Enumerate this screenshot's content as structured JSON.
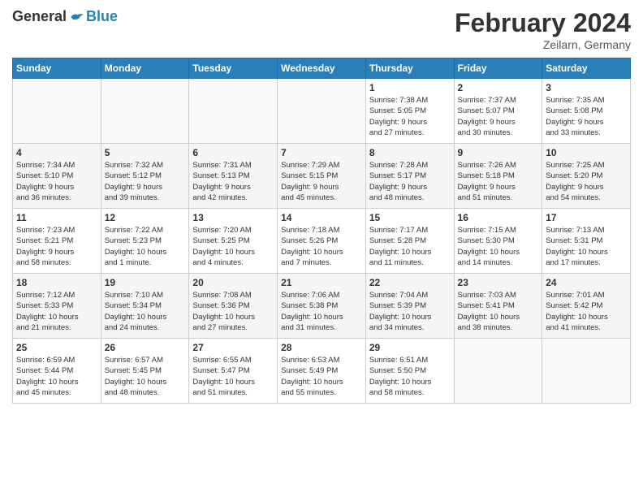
{
  "header": {
    "logo_general": "General",
    "logo_blue": "Blue",
    "title": "February 2024",
    "subtitle": "Zeilarn, Germany"
  },
  "columns": [
    "Sunday",
    "Monday",
    "Tuesday",
    "Wednesday",
    "Thursday",
    "Friday",
    "Saturday"
  ],
  "rows": [
    [
      {
        "day": "",
        "info": ""
      },
      {
        "day": "",
        "info": ""
      },
      {
        "day": "",
        "info": ""
      },
      {
        "day": "",
        "info": ""
      },
      {
        "day": "1",
        "info": "Sunrise: 7:38 AM\nSunset: 5:05 PM\nDaylight: 9 hours\nand 27 minutes."
      },
      {
        "day": "2",
        "info": "Sunrise: 7:37 AM\nSunset: 5:07 PM\nDaylight: 9 hours\nand 30 minutes."
      },
      {
        "day": "3",
        "info": "Sunrise: 7:35 AM\nSunset: 5:08 PM\nDaylight: 9 hours\nand 33 minutes."
      }
    ],
    [
      {
        "day": "4",
        "info": "Sunrise: 7:34 AM\nSunset: 5:10 PM\nDaylight: 9 hours\nand 36 minutes."
      },
      {
        "day": "5",
        "info": "Sunrise: 7:32 AM\nSunset: 5:12 PM\nDaylight: 9 hours\nand 39 minutes."
      },
      {
        "day": "6",
        "info": "Sunrise: 7:31 AM\nSunset: 5:13 PM\nDaylight: 9 hours\nand 42 minutes."
      },
      {
        "day": "7",
        "info": "Sunrise: 7:29 AM\nSunset: 5:15 PM\nDaylight: 9 hours\nand 45 minutes."
      },
      {
        "day": "8",
        "info": "Sunrise: 7:28 AM\nSunset: 5:17 PM\nDaylight: 9 hours\nand 48 minutes."
      },
      {
        "day": "9",
        "info": "Sunrise: 7:26 AM\nSunset: 5:18 PM\nDaylight: 9 hours\nand 51 minutes."
      },
      {
        "day": "10",
        "info": "Sunrise: 7:25 AM\nSunset: 5:20 PM\nDaylight: 9 hours\nand 54 minutes."
      }
    ],
    [
      {
        "day": "11",
        "info": "Sunrise: 7:23 AM\nSunset: 5:21 PM\nDaylight: 9 hours\nand 58 minutes."
      },
      {
        "day": "12",
        "info": "Sunrise: 7:22 AM\nSunset: 5:23 PM\nDaylight: 10 hours\nand 1 minute."
      },
      {
        "day": "13",
        "info": "Sunrise: 7:20 AM\nSunset: 5:25 PM\nDaylight: 10 hours\nand 4 minutes."
      },
      {
        "day": "14",
        "info": "Sunrise: 7:18 AM\nSunset: 5:26 PM\nDaylight: 10 hours\nand 7 minutes."
      },
      {
        "day": "15",
        "info": "Sunrise: 7:17 AM\nSunset: 5:28 PM\nDaylight: 10 hours\nand 11 minutes."
      },
      {
        "day": "16",
        "info": "Sunrise: 7:15 AM\nSunset: 5:30 PM\nDaylight: 10 hours\nand 14 minutes."
      },
      {
        "day": "17",
        "info": "Sunrise: 7:13 AM\nSunset: 5:31 PM\nDaylight: 10 hours\nand 17 minutes."
      }
    ],
    [
      {
        "day": "18",
        "info": "Sunrise: 7:12 AM\nSunset: 5:33 PM\nDaylight: 10 hours\nand 21 minutes."
      },
      {
        "day": "19",
        "info": "Sunrise: 7:10 AM\nSunset: 5:34 PM\nDaylight: 10 hours\nand 24 minutes."
      },
      {
        "day": "20",
        "info": "Sunrise: 7:08 AM\nSunset: 5:36 PM\nDaylight: 10 hours\nand 27 minutes."
      },
      {
        "day": "21",
        "info": "Sunrise: 7:06 AM\nSunset: 5:38 PM\nDaylight: 10 hours\nand 31 minutes."
      },
      {
        "day": "22",
        "info": "Sunrise: 7:04 AM\nSunset: 5:39 PM\nDaylight: 10 hours\nand 34 minutes."
      },
      {
        "day": "23",
        "info": "Sunrise: 7:03 AM\nSunset: 5:41 PM\nDaylight: 10 hours\nand 38 minutes."
      },
      {
        "day": "24",
        "info": "Sunrise: 7:01 AM\nSunset: 5:42 PM\nDaylight: 10 hours\nand 41 minutes."
      }
    ],
    [
      {
        "day": "25",
        "info": "Sunrise: 6:59 AM\nSunset: 5:44 PM\nDaylight: 10 hours\nand 45 minutes."
      },
      {
        "day": "26",
        "info": "Sunrise: 6:57 AM\nSunset: 5:45 PM\nDaylight: 10 hours\nand 48 minutes."
      },
      {
        "day": "27",
        "info": "Sunrise: 6:55 AM\nSunset: 5:47 PM\nDaylight: 10 hours\nand 51 minutes."
      },
      {
        "day": "28",
        "info": "Sunrise: 6:53 AM\nSunset: 5:49 PM\nDaylight: 10 hours\nand 55 minutes."
      },
      {
        "day": "29",
        "info": "Sunrise: 6:51 AM\nSunset: 5:50 PM\nDaylight: 10 hours\nand 58 minutes."
      },
      {
        "day": "",
        "info": ""
      },
      {
        "day": "",
        "info": ""
      }
    ]
  ]
}
